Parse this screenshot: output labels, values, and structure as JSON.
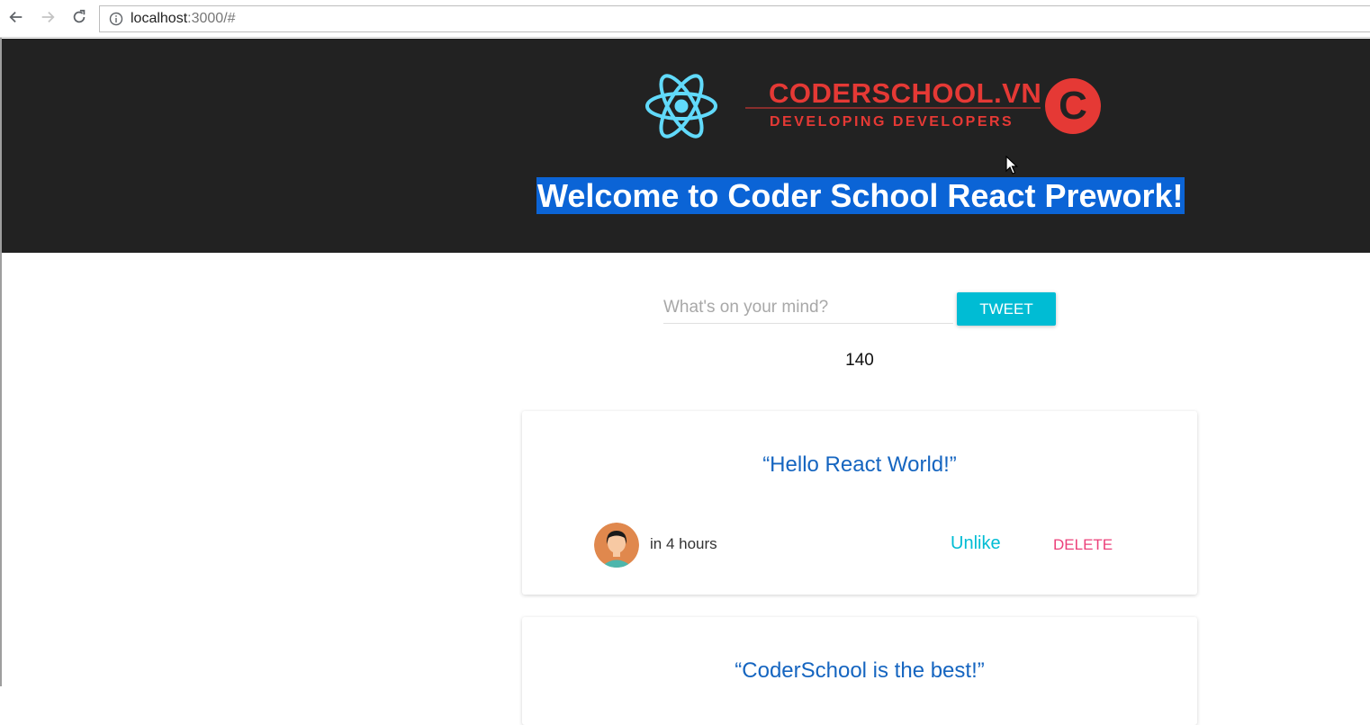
{
  "browser": {
    "url_host": "localhost",
    "url_rest": ":3000/#"
  },
  "header": {
    "welcome_text": "Welcome to Coder School React Prework!",
    "brand_name": "CODERSCHOOL.VN",
    "brand_tagline": "DEVELOPING DEVELOPERS",
    "brand_mark": "C",
    "background_color": "#222222",
    "highlight_color": "#0b64d6"
  },
  "compose": {
    "placeholder": "What's on your mind?",
    "tweet_button_label": "TWEET",
    "char_count": "140",
    "accent_color": "#00bcd4"
  },
  "tweets": [
    {
      "text": "“Hello React World!”",
      "time": "in 4 hours",
      "like_label": "Unlike",
      "delete_label": "DELETE"
    },
    {
      "text": "“CoderSchool is the best!”"
    }
  ]
}
